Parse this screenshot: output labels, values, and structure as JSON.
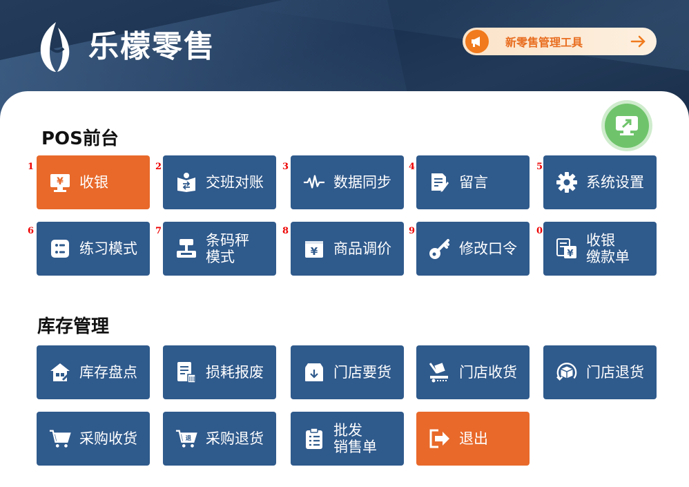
{
  "header": {
    "brand": "乐檬零售",
    "tool_link": "新零售管理工具"
  },
  "pos": {
    "title": "POS前台",
    "tiles": [
      {
        "num": "1",
        "label": "收银",
        "icon": "cashier-monitor-icon"
      },
      {
        "num": "2",
        "label": "交班对账",
        "icon": "shift-handover-icon"
      },
      {
        "num": "3",
        "label": "数据同步",
        "icon": "pulse-wave-icon"
      },
      {
        "num": "4",
        "label": "留言",
        "icon": "note-edit-icon"
      },
      {
        "num": "5",
        "label": "系统设置",
        "icon": "gear-icon"
      },
      {
        "num": "6",
        "label": "练习模式",
        "icon": "practice-icon"
      },
      {
        "num": "7",
        "label": "条码秤\n模式",
        "icon": "scale-icon"
      },
      {
        "num": "8",
        "label": "商品调价",
        "icon": "price-tag-icon"
      },
      {
        "num": "9",
        "label": "修改口令",
        "icon": "key-icon"
      },
      {
        "num": "0",
        "label": "收银\n缴款单",
        "icon": "payment-slip-icon"
      }
    ]
  },
  "inventory": {
    "title": "库存管理",
    "tiles": [
      {
        "label": "库存盘点",
        "icon": "warehouse-check-icon"
      },
      {
        "label": "损耗报废",
        "icon": "scrap-report-icon"
      },
      {
        "label": "门店要货",
        "icon": "store-request-icon"
      },
      {
        "label": "门店收货",
        "icon": "store-receive-icon"
      },
      {
        "label": "门店退货",
        "icon": "store-return-icon"
      },
      {
        "label": "采购收货",
        "icon": "cart-receive-icon"
      },
      {
        "label": "采购退货",
        "icon": "cart-return-icon"
      },
      {
        "label": "批发\n销售单",
        "icon": "wholesale-list-icon"
      },
      {
        "label": "退出",
        "icon": "exit-icon"
      }
    ]
  },
  "colors": {
    "tile_blue": "#2f5a8c",
    "tile_orange": "#e8692a",
    "accent_green": "#6fc46b",
    "number_red": "#e00000"
  }
}
